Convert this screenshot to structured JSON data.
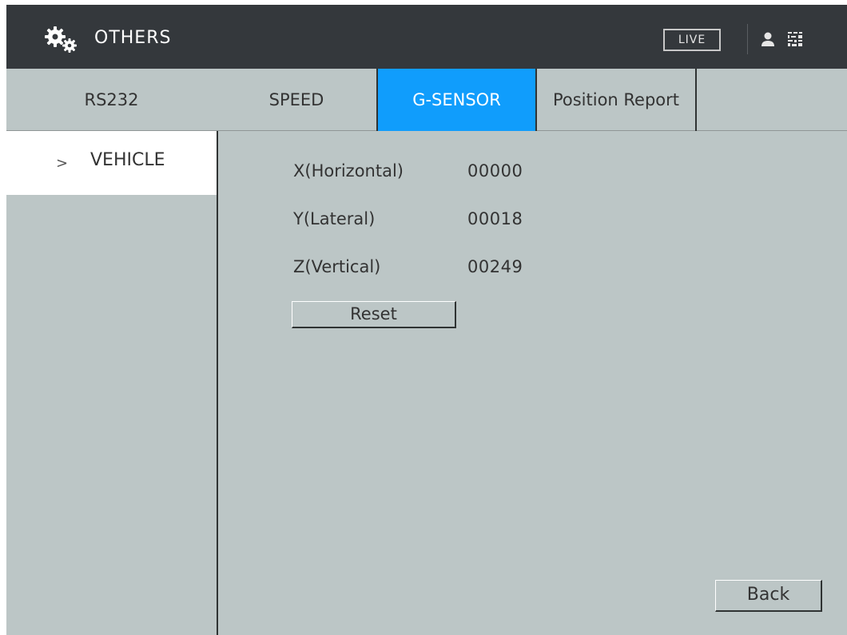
{
  "header": {
    "title": "OTHERS",
    "icon": "gears-icon",
    "live_label": "LIVE",
    "user_icon": "user-icon",
    "grid_icon": "grid-icon"
  },
  "tabs": [
    {
      "label": "RS232",
      "active": false
    },
    {
      "label": "SPEED",
      "active": false
    },
    {
      "label": "G-SENSOR",
      "active": true
    },
    {
      "label": "Position Report",
      "active": false
    }
  ],
  "sidebar": {
    "items": [
      {
        "label": "VEHICLE",
        "selected": true,
        "icon": "chevron-right-icon"
      }
    ]
  },
  "sensor": {
    "rows": [
      {
        "label": "X(Horizontal)",
        "value": "00000"
      },
      {
        "label": "Y(Lateral)",
        "value": "00018"
      },
      {
        "label": "Z(Vertical)",
        "value": "00249"
      }
    ]
  },
  "buttons": {
    "reset": "Reset",
    "back": "Back"
  },
  "colors": {
    "titlebar": "#34383c",
    "panel": "#bcc6c6",
    "active_tab": "#109dfc",
    "divider": "#2f3333"
  }
}
